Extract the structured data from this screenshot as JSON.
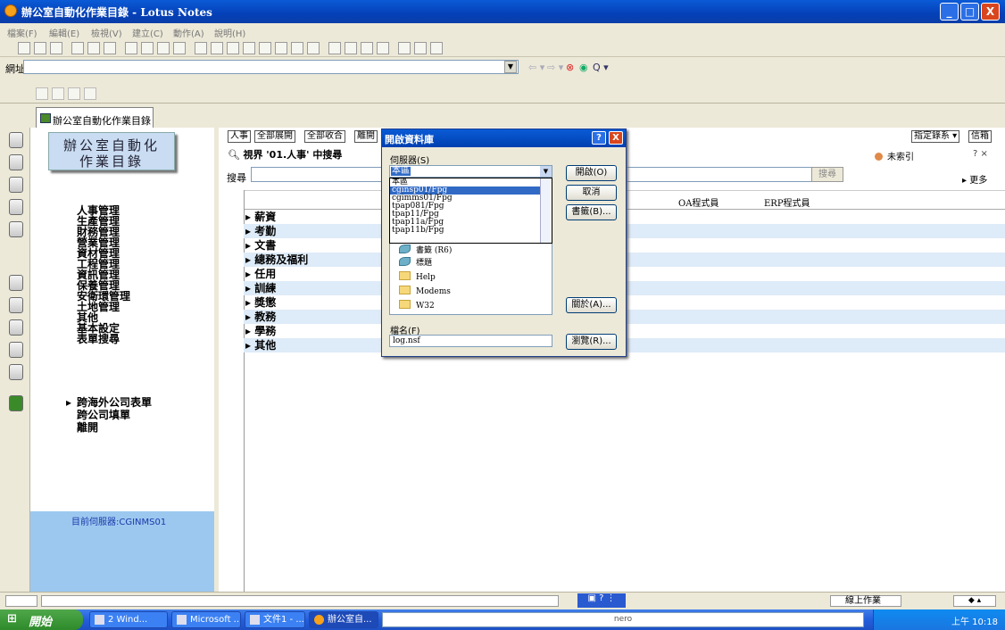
{
  "window": {
    "title": "辦公室自動化作業目錄 - Lotus Notes",
    "min": "_",
    "max": "□",
    "close": "X"
  },
  "menu": [
    "檔案(F)",
    "編輯(E)",
    "檢視(V)",
    "建立(C)",
    "動作(A)",
    "說明(H)"
  ],
  "address": {
    "label": "網址",
    "value": ""
  },
  "tab": {
    "label": "辦公室自動化作業目錄"
  },
  "nav": {
    "logo_line1": "辦公室自動化",
    "logo_line2": "作業目錄",
    "items": [
      "人事管理",
      "生產管理",
      "財務管理",
      "營業管理",
      "資材管理",
      "工程管理",
      "資訊管理",
      "保養管理",
      "安衛環管理",
      "土地管理",
      "其他",
      "基本設定",
      "表單搜尋"
    ],
    "items2": [
      "跨海外公司表單",
      "跨公司填單",
      "離開"
    ],
    "server_label": "目前伺服器:",
    "server_value": "CGINMS01"
  },
  "view": {
    "actions": [
      "人事",
      "全部展開",
      "全部收合",
      "離開"
    ],
    "right_actions": [
      "指定錄系 ▾",
      "信箱"
    ],
    "title": "視界 '01.人事' 中搜尋",
    "index_status": "未索引",
    "help_close": "? ×",
    "search_label": "搜尋",
    "search_button": "搜尋",
    "more": "▸ 更多",
    "columns": [
      "OA程式員",
      "ERP程式員"
    ],
    "rows": [
      "薪資",
      "考勤",
      "文書",
      "總務及福利",
      "任用",
      "訓練",
      "獎懲",
      "教務",
      "學務",
      "其他"
    ]
  },
  "dialog": {
    "title": "開啟資料庫",
    "help": "?",
    "close": "X",
    "server_label": "伺服器(S)",
    "server_value": "本區",
    "server_options": [
      "本區",
      "cginsp01/Fpg",
      "cgimms01/Fpg",
      "tpap081/Fpg",
      "tpap11/Fpg",
      "tpap11a/Fpg",
      "tpap11b/Fpg"
    ],
    "db_items": [
      "書籤 (R6)",
      "標題",
      "Help",
      "Modems",
      "W32"
    ],
    "buttons": {
      "open": "開啟(O)",
      "cancel": "取消",
      "bookmark": "書籤(B)...",
      "about": "關於(A)...",
      "browse": "瀏覽(R)..."
    },
    "filename_label": "檔名(F)",
    "filename_value": "log.nsf"
  },
  "status": {
    "online": "線上作業"
  },
  "taskbar": {
    "start": "開始",
    "tasks": [
      "2 Wind...",
      "Microsoft ...",
      "文件1 - ...",
      "辦公室自..."
    ],
    "nero": "nero",
    "clock": "上午 10:18"
  }
}
